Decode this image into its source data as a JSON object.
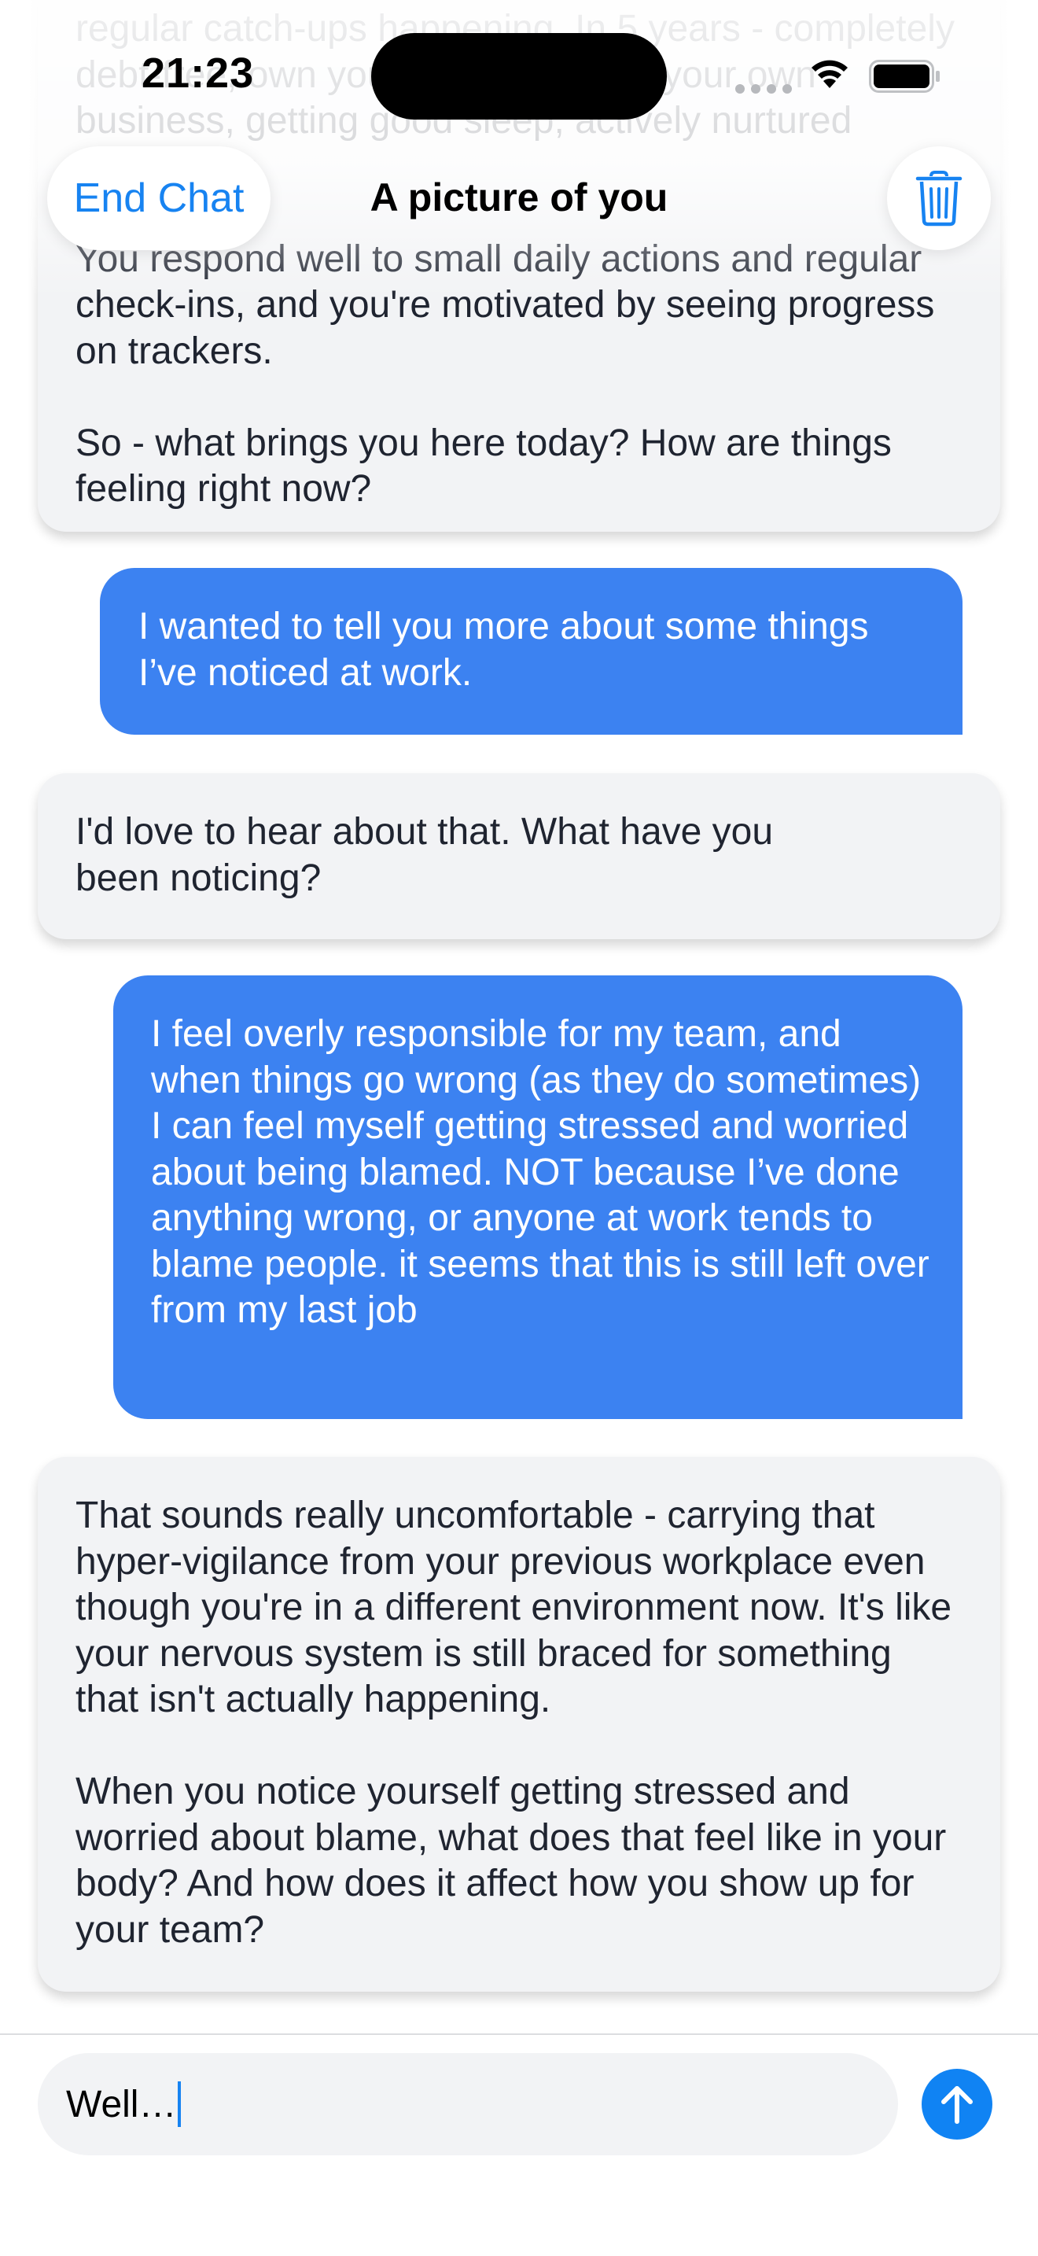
{
  "status_bar": {
    "time": "21:23"
  },
  "header": {
    "end_chat_label": "End Chat",
    "title": "A picture of you",
    "delete_icon": "trash-icon"
  },
  "messages": [
    {
      "role": "assistant",
      "text": "regular catch-ups happening. In 5 years - completely debt-free, own your home, running your own business, getting good sleep, actively nurtured friendships.\n\nYou respond well to small daily actions and regular check-ins, and you're motivated by seeing progress on trackers.\n\nSo - what brings you here today? How are things feeling right now?"
    },
    {
      "role": "user",
      "text": "I wanted to tell you more about some things I’ve noticed at work."
    },
    {
      "role": "assistant",
      "text": "I'd love to hear about that. What have you been noticing?"
    },
    {
      "role": "user",
      "text": "I feel overly responsible for my team, and when things go wrong (as they do sometimes) I can feel myself getting stressed and worried about being blamed. NOT because I’ve done anything wrong, or anyone at work tends to blame people. it seems that this is still left over from my last job"
    },
    {
      "role": "assistant",
      "text": "That sounds really uncomfortable - carrying that hyper-vigilance from your previous workplace even though you're in a different environment now. It's like your nervous system is still braced for something that isn't actually happening.\n\nWhen you notice yourself getting stressed and worried about blame, what does that feel like in your body? And how does it affect how you show up for your team?"
    }
  ],
  "composer": {
    "value": "Well…",
    "send_icon": "arrow-up-icon"
  },
  "colors": {
    "accent": "#1783f1",
    "user_bubble": "#3c82f1",
    "assistant_bubble": "#f2f3f5"
  }
}
